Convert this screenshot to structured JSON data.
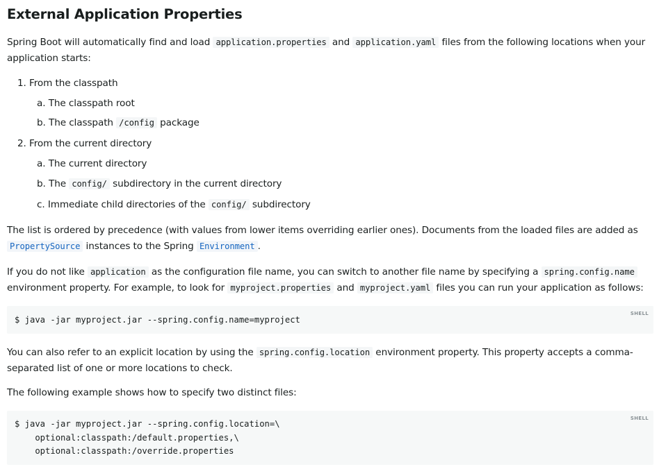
{
  "title": "External Application Properties",
  "intro": {
    "t1": "Spring Boot will automatically find and load ",
    "c1": "application.properties",
    "t2": " and ",
    "c2": "application.yaml",
    "t3": " files from the following locations when your application starts:"
  },
  "list": {
    "item1": {
      "marker": "1.",
      "label": "From the classpath"
    },
    "item1a": {
      "marker": "a.",
      "label": "The classpath root"
    },
    "item1b": {
      "marker": "b.",
      "t1": "The classpath ",
      "code": "/config",
      "t2": " package"
    },
    "item2": {
      "marker": "2.",
      "label": "From the current directory"
    },
    "item2a": {
      "marker": "a.",
      "label": "The current directory"
    },
    "item2b": {
      "marker": "b.",
      "t1": "The ",
      "code": "config/",
      "t2": " subdirectory in the current directory"
    },
    "item2c": {
      "marker": "c.",
      "t1": "Immediate child directories of the ",
      "code": "config/",
      "t2": " subdirectory"
    }
  },
  "para2": {
    "t1": "The list is ordered by precedence (with values from lower items overriding earlier ones). Documents from the loaded files are added as ",
    "c1": "PropertySource",
    "t2": " instances to the Spring ",
    "c2": "Environment",
    "t3": "."
  },
  "para3": {
    "t1": "If you do not like ",
    "c1": "application",
    "t2": " as the configuration file name, you can switch to another file name by specifying a ",
    "c2": "spring.config.name",
    "t3": " environment property. For example, to look for ",
    "c3": "myproject.properties",
    "t4": " and ",
    "c4": "myproject.yaml",
    "t5": " files you can run your application as follows:"
  },
  "code1": {
    "lang": "SHELL",
    "text": "$ java -jar myproject.jar --spring.config.name=myproject"
  },
  "para4": {
    "t1": "You can also refer to an explicit location by using the ",
    "c1": "spring.config.location",
    "t2": " environment property. This property accepts a comma-separated list of one or more locations to check."
  },
  "para5": {
    "text": "The following example shows how to specify two distinct files:"
  },
  "code2": {
    "lang": "SHELL",
    "text": "$ java -jar myproject.jar --spring.config.location=\\\n    optional:classpath:/default.properties,\\\n    optional:classpath:/override.properties"
  },
  "colors": {
    "text": "#191e1e",
    "link": "#1565c0",
    "code_bg": "#f4f6f7",
    "codeblock_bg": "#f6f8f8"
  }
}
